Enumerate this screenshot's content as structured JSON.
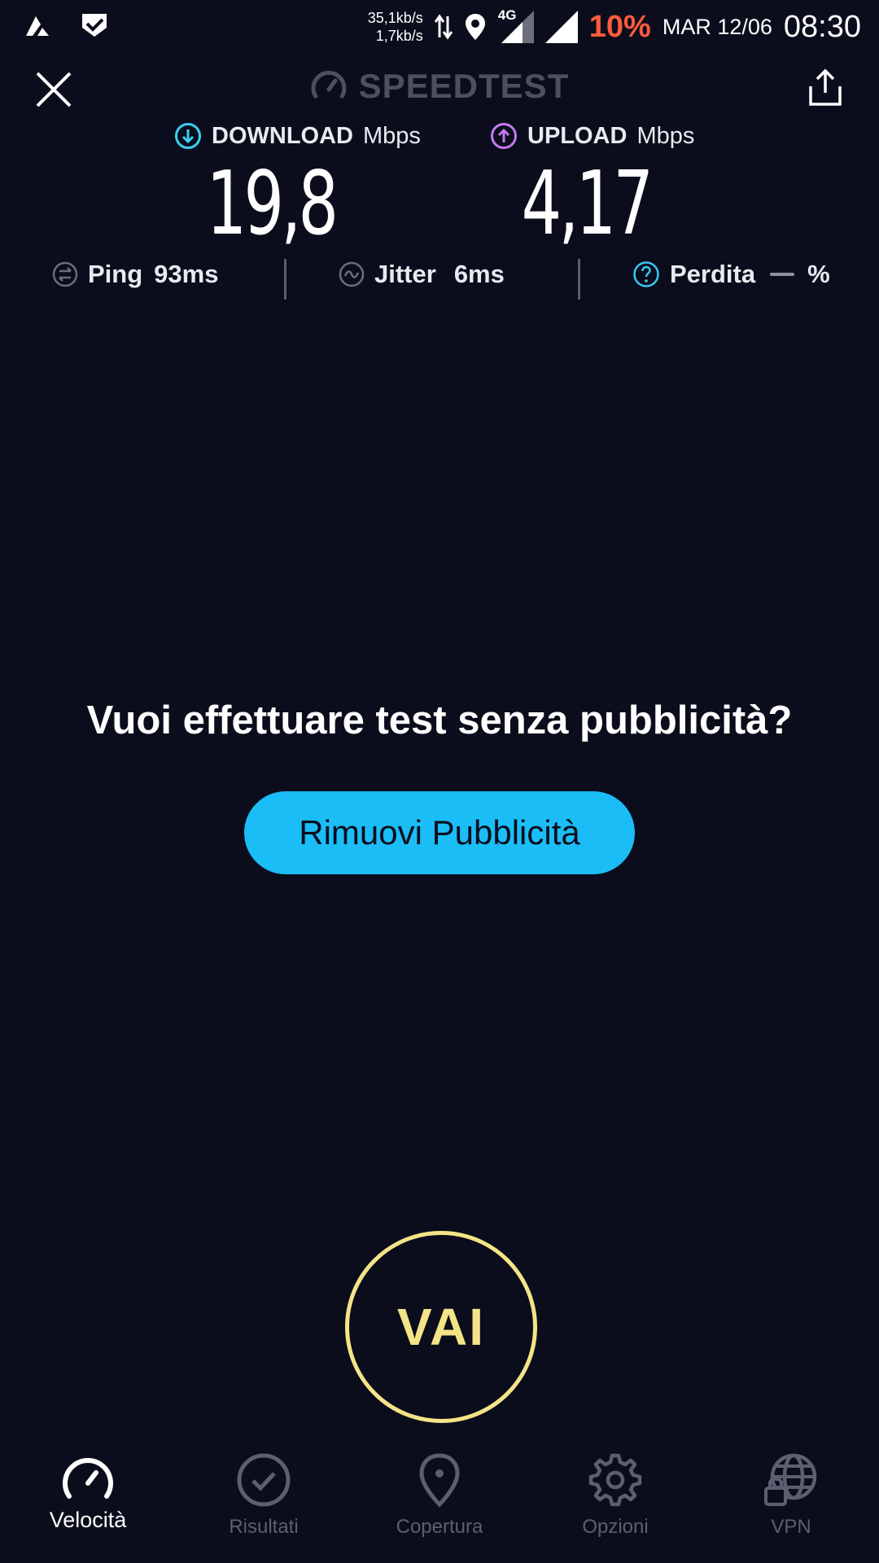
{
  "status_bar": {
    "net_down": "35,1kb/s",
    "net_up": "1,7kb/s",
    "network_type": "4G",
    "battery": "10%",
    "date": "MAR 12/06",
    "time": "08:30",
    "icons": [
      "app-notification-icon",
      "check-notification-icon",
      "data-arrows-icon",
      "location-icon",
      "signal-4g-icon",
      "signal-icon"
    ]
  },
  "header": {
    "title": "SPEEDTEST",
    "close_icon": "close-icon",
    "share_icon": "share-icon"
  },
  "results": {
    "download": {
      "label": "DOWNLOAD",
      "unit": "Mbps",
      "value": "19,8",
      "color": "#38d0f0"
    },
    "upload": {
      "label": "UPLOAD",
      "unit": "Mbps",
      "value": "4,17",
      "color": "#c777f0"
    },
    "ping": {
      "label": "Ping",
      "value": "93ms"
    },
    "jitter": {
      "label": "Jitter",
      "value": "6ms"
    },
    "loss": {
      "label": "Perdita",
      "unit": "%"
    }
  },
  "promo": {
    "text": "Vuoi effettuare test senza pubblicità?",
    "button_label": "Rimuovi Pubblicità",
    "button_color": "#1bbdf6"
  },
  "go_button": {
    "label": "VAI",
    "color": "#f4e487"
  },
  "nav": {
    "items": [
      {
        "label": "Velocità",
        "icon": "speedometer-icon",
        "active": true
      },
      {
        "label": "Risultati",
        "icon": "check-circle-icon",
        "active": false
      },
      {
        "label": "Copertura",
        "icon": "map-pin-icon",
        "active": false
      },
      {
        "label": "Opzioni",
        "icon": "gear-icon",
        "active": false
      },
      {
        "label": "VPN",
        "icon": "globe-lock-icon",
        "active": false
      }
    ]
  }
}
